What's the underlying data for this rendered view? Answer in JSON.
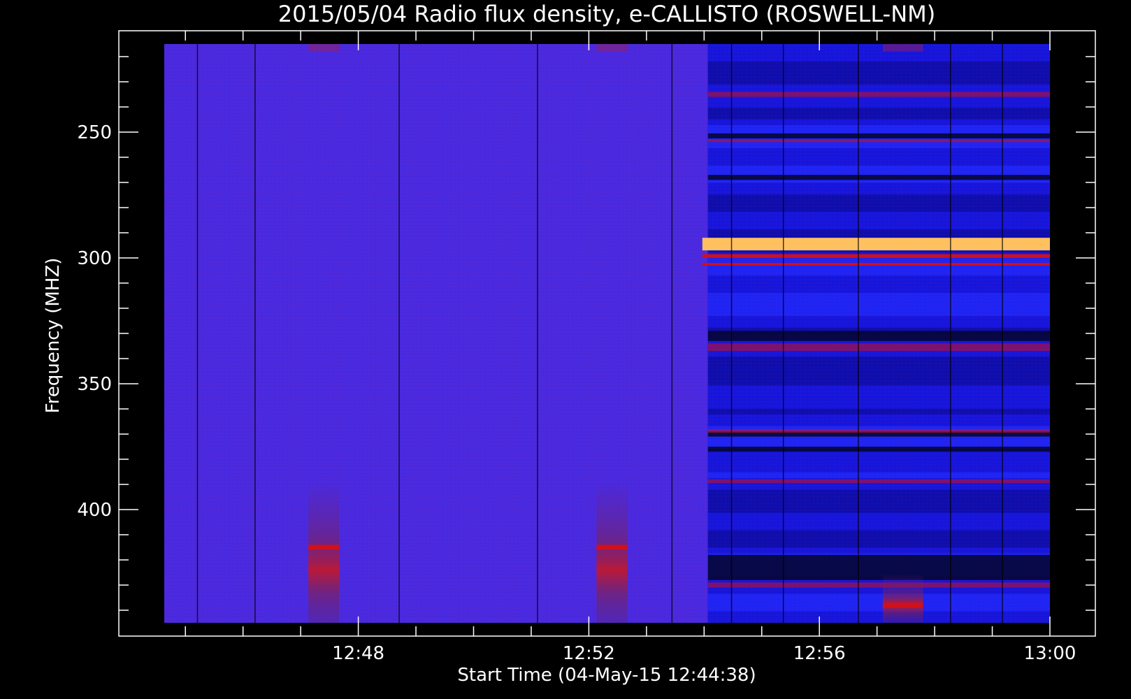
{
  "chart_data": {
    "type": "heatmap",
    "title": "2015/05/04  Radio flux density, e-CALLISTO (ROSWELL-NM)",
    "xlabel": "Start Time (04-May-15 12:44:38)",
    "ylabel": "Frequency (MHZ)",
    "x_range_minutes": [
      "12:44:38",
      "13:00:00"
    ],
    "y_range_mhz": [
      215,
      445
    ],
    "y_inverted": true,
    "xticks": [
      "12:48",
      "12:52",
      "12:56",
      "13:00"
    ],
    "yticks": [
      "250",
      "300",
      "350",
      "400"
    ],
    "ytick_values": [
      250,
      300,
      350,
      400
    ],
    "colormap": "blue-red-yellow",
    "colors": {
      "background": "#000000",
      "quiet_level": "#4a2ae0",
      "post_jump_level": "#1a1af0",
      "dark_band": "#05052a",
      "red_band": "#d0101a",
      "yellow_band": "#ffc060"
    },
    "level_change_time": "12:54:04",
    "strong_bands_after_jump_mhz": [
      {
        "from": 292,
        "to": 297,
        "level": "yellow"
      },
      {
        "from": 298.5,
        "to": 300,
        "level": "red"
      },
      {
        "from": 302,
        "to": 303,
        "level": "red"
      }
    ],
    "dark_bands_after_jump_mhz": [
      {
        "from": 250.5,
        "to": 252.5
      },
      {
        "from": 267,
        "to": 269
      },
      {
        "from": 329,
        "to": 333
      },
      {
        "from": 369,
        "to": 371
      },
      {
        "from": 375,
        "to": 377
      },
      {
        "from": 418,
        "to": 428
      }
    ],
    "red_bands_after_jump_mhz": [
      {
        "from": 234,
        "to": 236
      },
      {
        "from": 253,
        "to": 254
      },
      {
        "from": 334,
        "to": 337
      },
      {
        "from": 368,
        "to": 369.5
      },
      {
        "from": 388,
        "to": 389.5
      },
      {
        "from": 429,
        "to": 431
      }
    ],
    "time_columns": [
      {
        "start": "12:47:08",
        "end": "12:47:40",
        "from_mhz": 390,
        "to_mhz": 445,
        "peak_mhz": 415,
        "level": "red"
      },
      {
        "start": "12:52:08",
        "end": "12:52:40",
        "from_mhz": 390,
        "to_mhz": 445,
        "peak_mhz": 415,
        "level": "red"
      },
      {
        "start": "12:57:06",
        "end": "12:57:48",
        "from_mhz": 426,
        "to_mhz": 445,
        "peak_mhz": 438,
        "level": "red"
      }
    ],
    "data_gaps_times": [
      "12:45:12",
      "12:46:12",
      "12:48:42",
      "12:51:06",
      "12:53:26",
      "12:54:28",
      "12:55:22",
      "12:56:40",
      "12:58:16",
      "12:59:10"
    ]
  }
}
